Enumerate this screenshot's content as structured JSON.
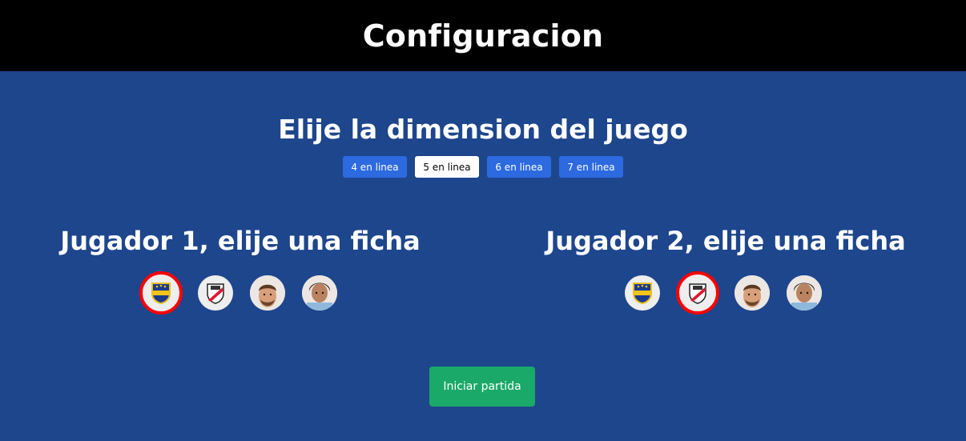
{
  "header": {
    "title": "Configuracion"
  },
  "dimension": {
    "title": "Elije la dimension del juego",
    "options": [
      {
        "label": "4 en linea",
        "selected": false
      },
      {
        "label": "5 en linea",
        "selected": true
      },
      {
        "label": "6 en linea",
        "selected": false
      },
      {
        "label": "7 en linea",
        "selected": false
      }
    ]
  },
  "players": [
    {
      "title": "Jugador 1, elije una ficha",
      "tokens": [
        {
          "icon": "boca-juniors-crest-icon",
          "selected": true
        },
        {
          "icon": "river-plate-crest-icon",
          "selected": false
        },
        {
          "icon": "messi-face-icon",
          "selected": false
        },
        {
          "icon": "maradona-face-icon",
          "selected": false
        }
      ]
    },
    {
      "title": "Jugador 2, elije una ficha",
      "tokens": [
        {
          "icon": "boca-juniors-crest-icon",
          "selected": false
        },
        {
          "icon": "river-plate-crest-icon",
          "selected": true
        },
        {
          "icon": "messi-face-icon",
          "selected": false
        },
        {
          "icon": "maradona-face-icon",
          "selected": false
        }
      ]
    }
  ],
  "start_button": {
    "label": "Iniciar partida"
  },
  "colors": {
    "background": "#1e468d",
    "header_background": "#000000",
    "dimension_button": "#2d6ae0",
    "dimension_button_selected": "#ffffff",
    "selected_token_border": "#ff0000",
    "start_button": "#1aa968"
  }
}
